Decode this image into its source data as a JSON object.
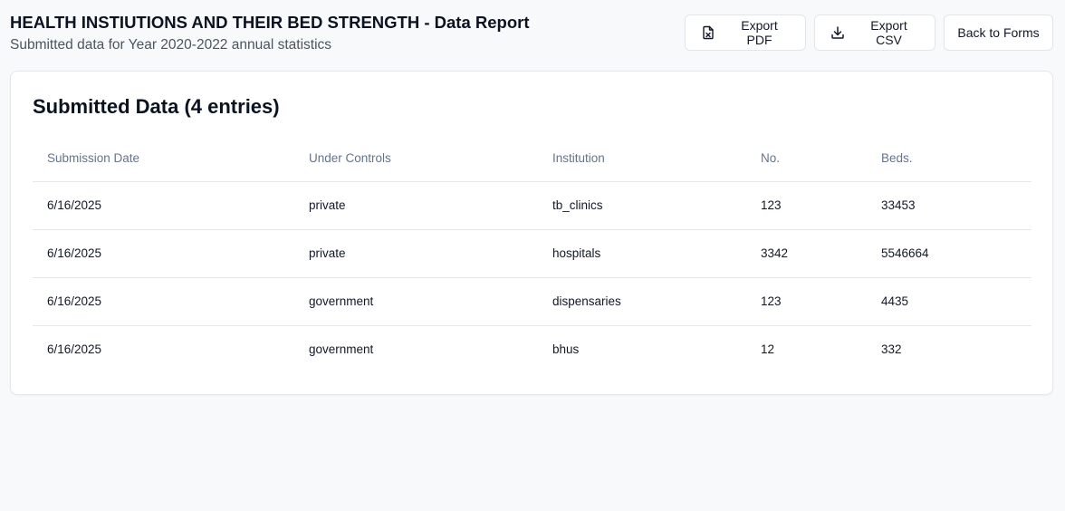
{
  "header": {
    "title": "HEALTH INSTIUTIONS AND THEIR BED STRENGTH - Data Report",
    "subtitle": "Submitted data for Year 2020-2022 annual statistics"
  },
  "actions": {
    "export_pdf_label": "Export PDF",
    "export_pdf_icon": "file-pdf-icon",
    "export_csv_label": "Export CSV",
    "export_csv_icon": "download-icon",
    "back_label": "Back to Forms"
  },
  "table": {
    "title": "Submitted Data (4 entries)",
    "columns": [
      "Submission Date",
      "Under Controls",
      "Institution",
      "No.",
      "Beds."
    ],
    "rows": [
      [
        "6/16/2025",
        "private",
        "tb_clinics",
        "123",
        "33453"
      ],
      [
        "6/16/2025",
        "private",
        "hospitals",
        "3342",
        "5546664"
      ],
      [
        "6/16/2025",
        "government",
        "dispensaries",
        "123",
        "4435"
      ],
      [
        "6/16/2025",
        "government",
        "bhus",
        "12",
        "332"
      ]
    ]
  },
  "colors": {
    "background": "#f8f9fb",
    "card": "#ffffff",
    "border": "#e5e7eb",
    "header_text": "#64748b"
  }
}
